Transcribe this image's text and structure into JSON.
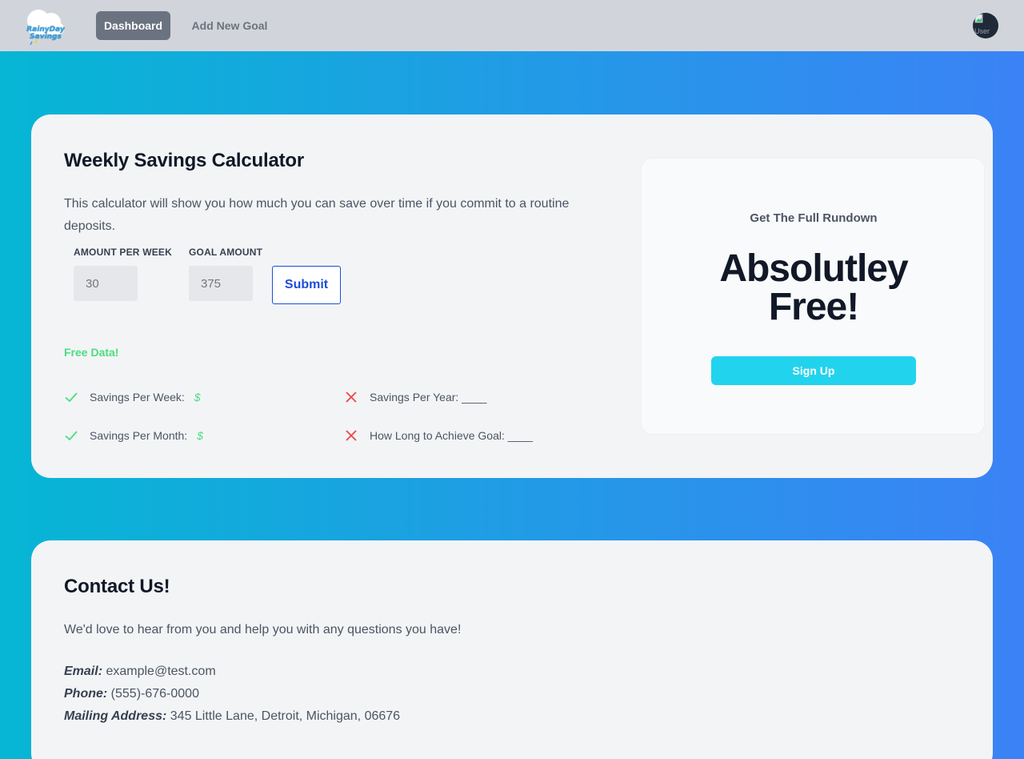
{
  "nav": {
    "logo_text_line1": "RainyDay",
    "logo_text_line2": "Savings",
    "dashboard_label": "Dashboard",
    "add_goal_label": "Add New Goal",
    "avatar_alt": "User"
  },
  "calculator": {
    "title": "Weekly Savings Calculator",
    "description": "This calculator will show you how much you can save over time if you commit to a routine deposits.",
    "amount_label": "AMOUNT PER WEEK",
    "amount_placeholder": "30",
    "goal_label": "GOAL AMOUNT",
    "goal_placeholder": "375",
    "submit_label": "Submit",
    "free_data_label": "Free Data!",
    "features": [
      {
        "label": "Savings Per Week:",
        "value": "$",
        "status": "check"
      },
      {
        "label": "Savings Per Month:",
        "value": "$",
        "status": "check"
      },
      {
        "label": "Savings Per Year: ____",
        "status": "cross"
      },
      {
        "label": "How Long to Achieve Goal: ____",
        "status": "cross"
      }
    ]
  },
  "promo": {
    "subtitle": "Get The Full Rundown",
    "headline": "Absolutley Free!",
    "signup_label": "Sign Up"
  },
  "contact": {
    "title": "Contact Us!",
    "description": "We'd love to hear from you and help you with any questions you have!",
    "email_label": "Email:",
    "email_value": "example@test.com",
    "phone_label": "Phone:",
    "phone_value": "(555)-676-0000",
    "address_label": "Mailing Address:",
    "address_value": "345 Little Lane, Detroit, Michigan, 06676"
  },
  "colors": {
    "gradient_start": "#06b6d4",
    "gradient_end": "#3b82f6",
    "navbar_bg": "#d1d5db",
    "check_green": "#4ade80",
    "cross_red": "#ef4444",
    "signup_cyan": "#22d3ee",
    "submit_blue": "#1d4ed8"
  }
}
